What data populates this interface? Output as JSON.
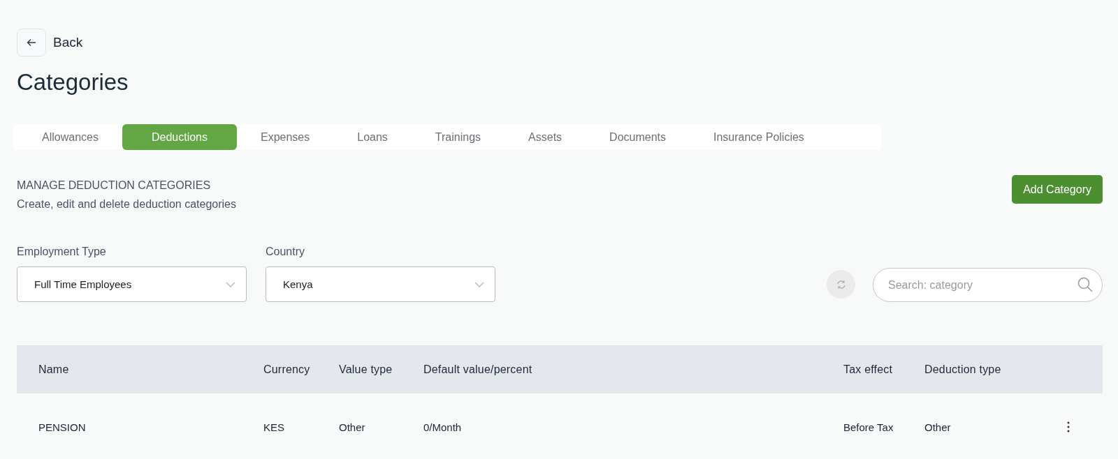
{
  "back": {
    "label": "Back"
  },
  "title": "Categories",
  "tabs": [
    {
      "label": "Allowances",
      "selected": false
    },
    {
      "label": "Deductions",
      "selected": true
    },
    {
      "label": "Expenses",
      "selected": false
    },
    {
      "label": "Loans",
      "selected": false
    },
    {
      "label": "Trainings",
      "selected": false
    },
    {
      "label": "Assets",
      "selected": false
    },
    {
      "label": "Documents",
      "selected": false
    },
    {
      "label": "Insurance Policies",
      "selected": false
    }
  ],
  "section": {
    "heading": "MANAGE DEDUCTION CATEGORIES",
    "description": "Create, edit and delete deduction categories",
    "button": "Add Category"
  },
  "filters": [
    {
      "label": "Employment Type",
      "value": "Full Time Employees"
    },
    {
      "label": "Country",
      "value": "Kenya"
    }
  ],
  "search": {
    "placeholder": "Search: category"
  },
  "table": {
    "columns": [
      "Name",
      "Currency",
      "Value type",
      "Default value/percent",
      "Tax effect",
      "Deduction type"
    ],
    "rows": [
      [
        "PENSION",
        "KES",
        "Other",
        "0/Month",
        "Before Tax",
        "Other"
      ]
    ]
  }
}
